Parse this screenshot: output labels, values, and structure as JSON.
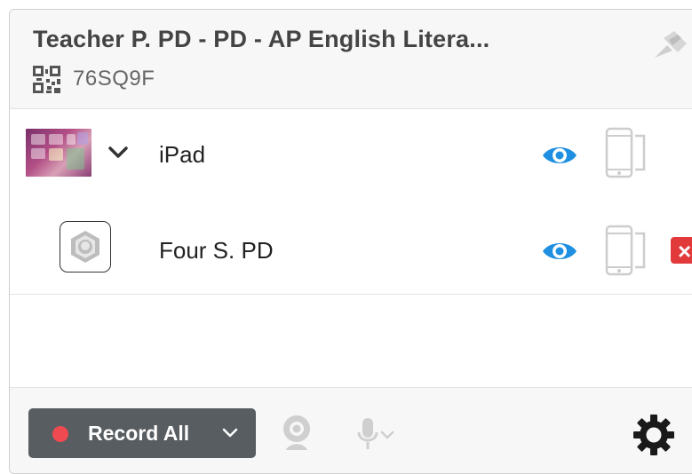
{
  "header": {
    "title": "Teacher P. PD - PD - AP English Litera...",
    "code": "76SQ9F",
    "qr_icon": "qr-code-icon",
    "pin_icon": "pin-icon"
  },
  "devices": [
    {
      "name": "iPad",
      "thumbnail": "screen-thumbnail",
      "expand_icon": "chevron-down-icon",
      "view_icon": "eye-icon",
      "device_icon": "phone-outline-icon"
    },
    {
      "name": "Four S. PD",
      "thumbnail": "user-avatar-icon",
      "view_icon": "eye-icon",
      "device_icon": "phone-outline-icon",
      "remove_icon": "close-icon",
      "remove_symbol": "×"
    }
  ],
  "footer": {
    "record_label": "Record All",
    "record_dropdown_icon": "chevron-down-icon",
    "webcam_icon": "webcam-icon",
    "mic_icon": "microphone-icon",
    "settings_icon": "gear-icon"
  },
  "colors": {
    "accent_blue": "#1e8fe1",
    "record_button": "#585d62",
    "record_dot": "#ef4a51",
    "remove_red": "#e23a3a"
  }
}
